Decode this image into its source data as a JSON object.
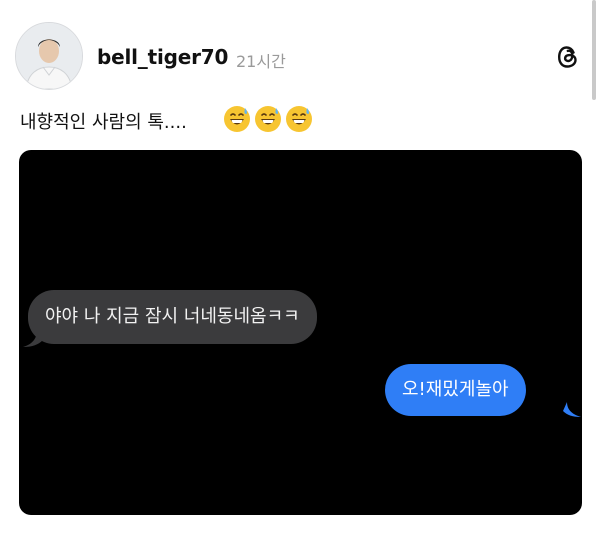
{
  "post": {
    "username": "bell_tiger70",
    "timestamp": "21시간",
    "text": "내향적인 사람의 톡....",
    "emojis": [
      "grinning-sweat-emoji",
      "grinning-sweat-emoji",
      "grinning-sweat-emoji"
    ]
  },
  "chat": {
    "incoming_message": "야야 나 지금 잠시 너네동네옴ㅋㅋ",
    "outgoing_message": "오!재밌게놀아"
  },
  "icons": {
    "app": "threads-icon",
    "profile": "avatar"
  },
  "colors": {
    "incoming_bubble": "#3b3b3d",
    "outgoing_bubble": "#2f7ef6",
    "media_background": "#000000",
    "timestamp": "#9a9a9a"
  }
}
